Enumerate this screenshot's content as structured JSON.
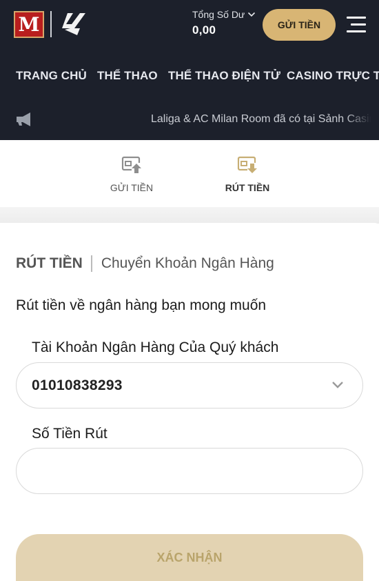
{
  "header": {
    "brand_logo": "mansion88-logo",
    "partner_logo": "laliga-logo",
    "balance": {
      "label": "Tổng Số Dư",
      "value": "0,00"
    },
    "deposit_button_label": "GỬI TIỀN",
    "menu_icon": "hamburger-menu-icon"
  },
  "nav": {
    "items": [
      {
        "label": "TRANG CHỦ"
      },
      {
        "label": "THỂ THAO"
      },
      {
        "label": "THỂ THAO ĐIỆN TỬ"
      },
      {
        "label": "CASINO TRỰC TUYẾN"
      }
    ]
  },
  "ticker": {
    "icon": "megaphone-icon",
    "text": "Laliga & AC Milan Room đã có tại Sảnh Casino"
  },
  "tabs": [
    {
      "label": "GỬI TIỀN",
      "icon": "deposit-icon",
      "active": false
    },
    {
      "label": "RÚT TIỀN",
      "icon": "withdraw-icon",
      "active": true
    }
  ],
  "form": {
    "title": "RÚT TIỀN",
    "method": "Chuyển Khoản Ngân Hàng",
    "subtitle": "Rút tiền về ngân hàng bạn mong muốn",
    "bank_account_label": "Tài Khoản Ngân Hàng Của Quý khách",
    "bank_account_value": "01010838293",
    "amount_label": "Số Tiền Rút",
    "amount_value": "",
    "amount_placeholder": "",
    "confirm_label": "XÁC NHẬN"
  },
  "colors": {
    "header_bg": "#1c202b",
    "accent_gold": "#d8b574",
    "active_icon": "#c7ae74",
    "inactive_icon": "#8e8e8e",
    "confirm_disabled_bg": "#e3d3b2",
    "confirm_disabled_text": "#b9a46b"
  }
}
